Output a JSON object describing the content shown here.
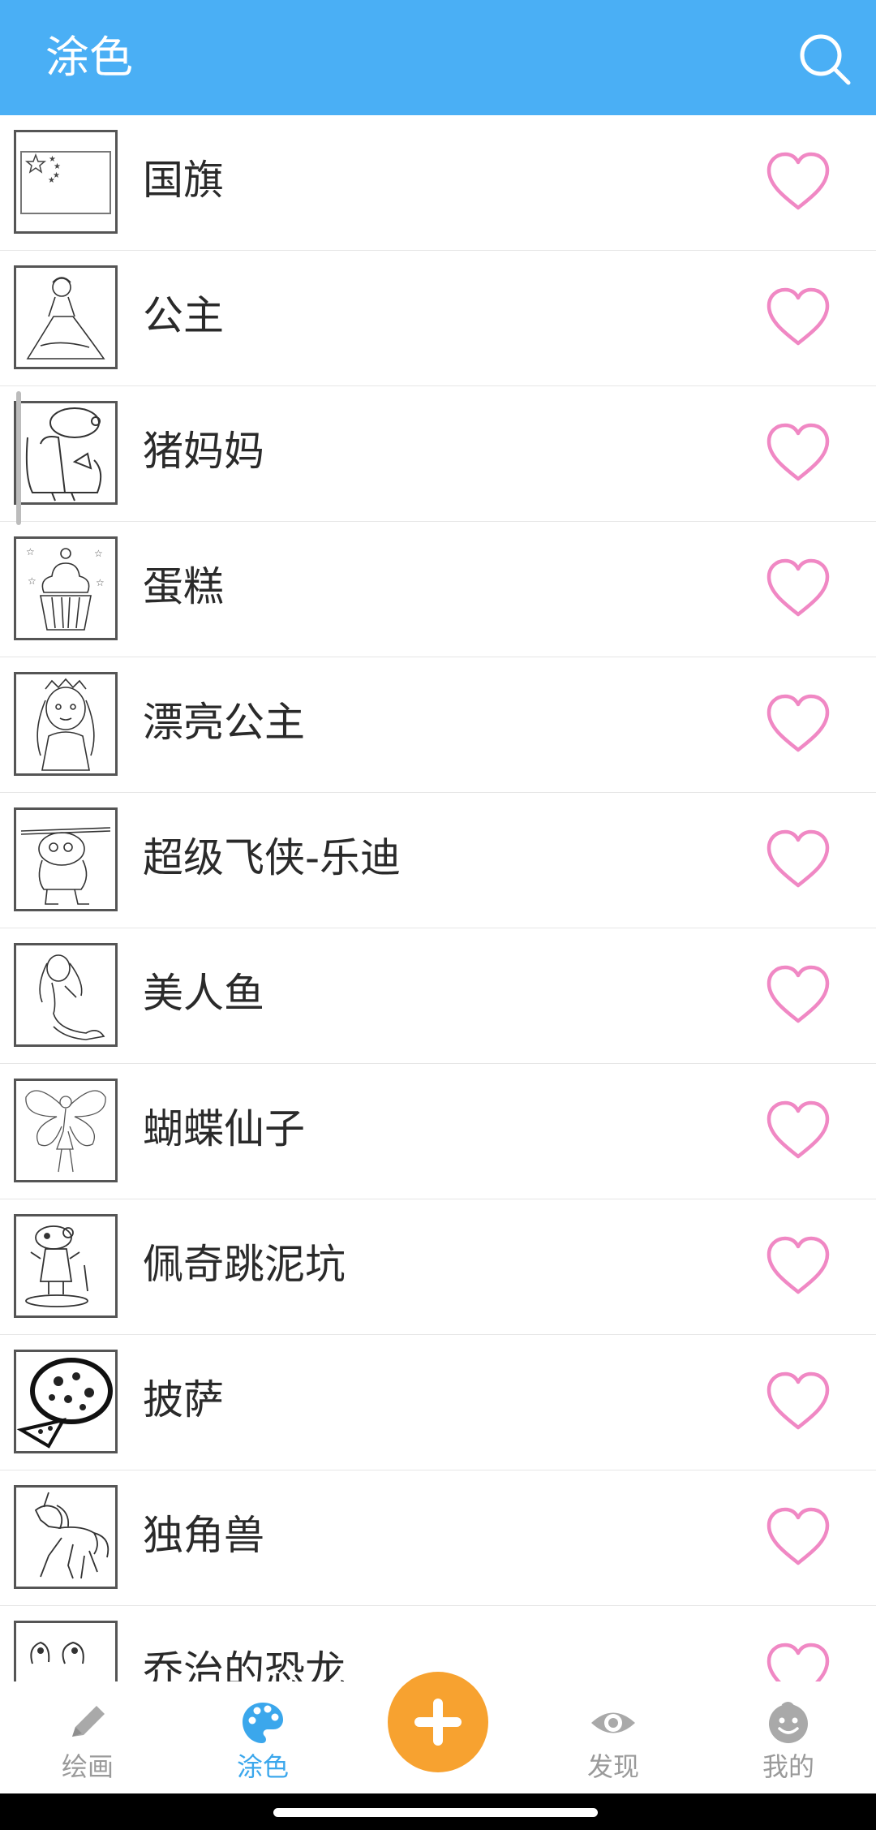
{
  "header": {
    "title": "涂色"
  },
  "items": [
    {
      "label": "国旗",
      "thumb": "flag-thumbnail"
    },
    {
      "label": "公主",
      "thumb": "princess-thumbnail"
    },
    {
      "label": "猪妈妈",
      "thumb": "mummy-pig-thumbnail"
    },
    {
      "label": "蛋糕",
      "thumb": "cupcake-thumbnail"
    },
    {
      "label": "漂亮公主",
      "thumb": "pretty-princess-thumbnail"
    },
    {
      "label": "超级飞侠-乐迪",
      "thumb": "jett-robot-thumbnail"
    },
    {
      "label": "美人鱼",
      "thumb": "mermaid-thumbnail"
    },
    {
      "label": "蝴蝶仙子",
      "thumb": "butterfly-fairy-thumbnail"
    },
    {
      "label": "佩奇跳泥坑",
      "thumb": "peppa-puddle-thumbnail"
    },
    {
      "label": "披萨",
      "thumb": "pizza-thumbnail"
    },
    {
      "label": "独角兽",
      "thumb": "unicorn-thumbnail"
    },
    {
      "label": "乔治的恐龙",
      "thumb": "george-dinosaur-thumbnail"
    }
  ],
  "tabs": [
    {
      "label": "绘画",
      "icon": "pencil-icon",
      "active": false
    },
    {
      "label": "涂色",
      "icon": "palette-icon",
      "active": true
    },
    {
      "label": "",
      "icon": "plus-icon",
      "active": false
    },
    {
      "label": "发现",
      "icon": "eye-icon",
      "active": false
    },
    {
      "label": "我的",
      "icon": "face-icon",
      "active": false
    }
  ],
  "colors": {
    "header": "#4aaff5",
    "heart": "#f088c4",
    "active_tab": "#3ba7ec",
    "fab": "#f7a230"
  }
}
